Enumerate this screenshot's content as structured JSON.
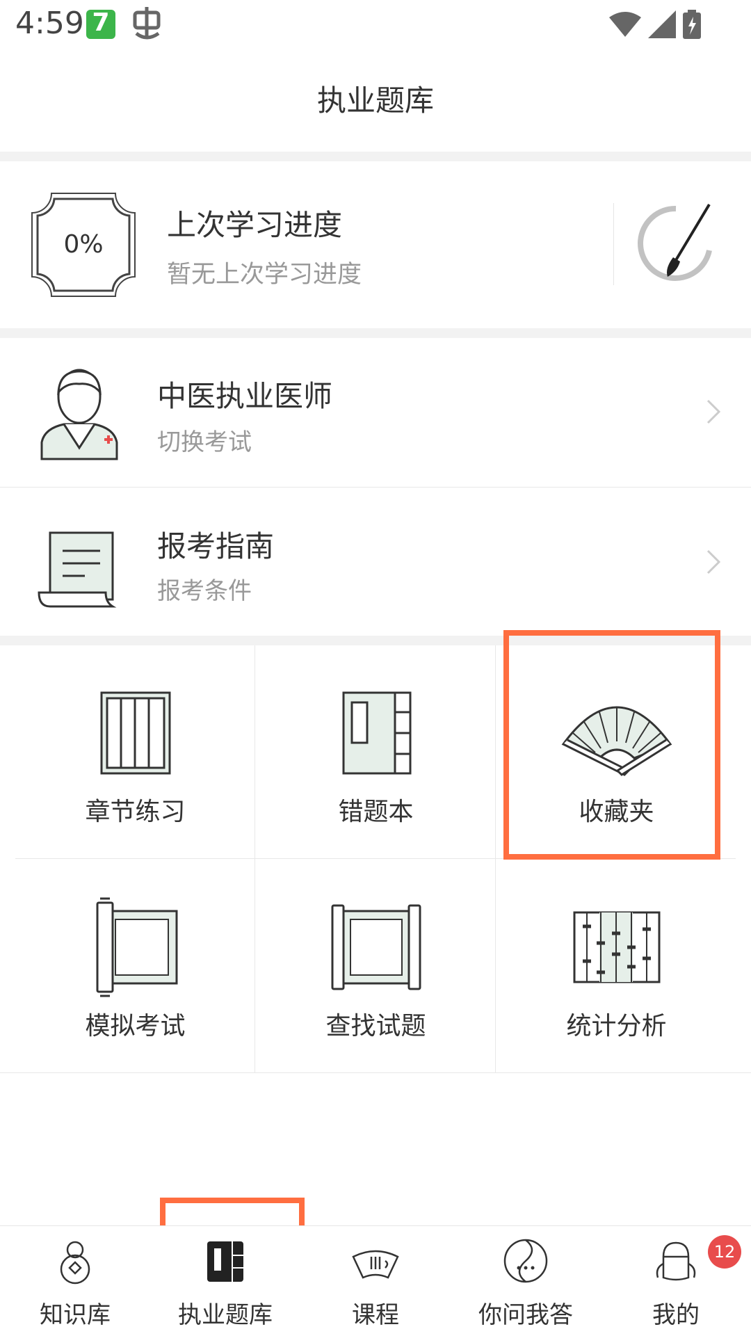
{
  "status_bar": {
    "time": "4:59",
    "app_badge": "7"
  },
  "header": {
    "title": "执业题库"
  },
  "progress": {
    "percent_label": "0%",
    "title": "上次学习进度",
    "subtitle": "暂无上次学习进度"
  },
  "exam_row": {
    "title": "中医执业医师",
    "subtitle": "切换考试"
  },
  "guide_row": {
    "title": "报考指南",
    "subtitle": "报考条件"
  },
  "grid": {
    "items": [
      {
        "label": "章节练习",
        "icon": "bookshelf-icon"
      },
      {
        "label": "错题本",
        "icon": "book-icon"
      },
      {
        "label": "收藏夹",
        "icon": "fan-icon"
      },
      {
        "label": "模拟考试",
        "icon": "scroll-icon"
      },
      {
        "label": "查找试题",
        "icon": "scroll-frame-icon"
      },
      {
        "label": "统计分析",
        "icon": "abacus-icon"
      }
    ]
  },
  "tabs": [
    {
      "label": "知识库",
      "icon": "gourd-icon"
    },
    {
      "label": "执业题库",
      "icon": "notebook-icon",
      "active": true
    },
    {
      "label": "课程",
      "icon": "fan-tab-icon"
    },
    {
      "label": "你问我答",
      "icon": "yinyang-icon"
    },
    {
      "label": "我的",
      "icon": "person-icon"
    }
  ],
  "profile_badge": "12",
  "colors": {
    "accent_green": "#3cb54a",
    "highlight": "#ff6e40",
    "badge_red": "#e84c4c",
    "icon_fill": "#e6efe9"
  }
}
